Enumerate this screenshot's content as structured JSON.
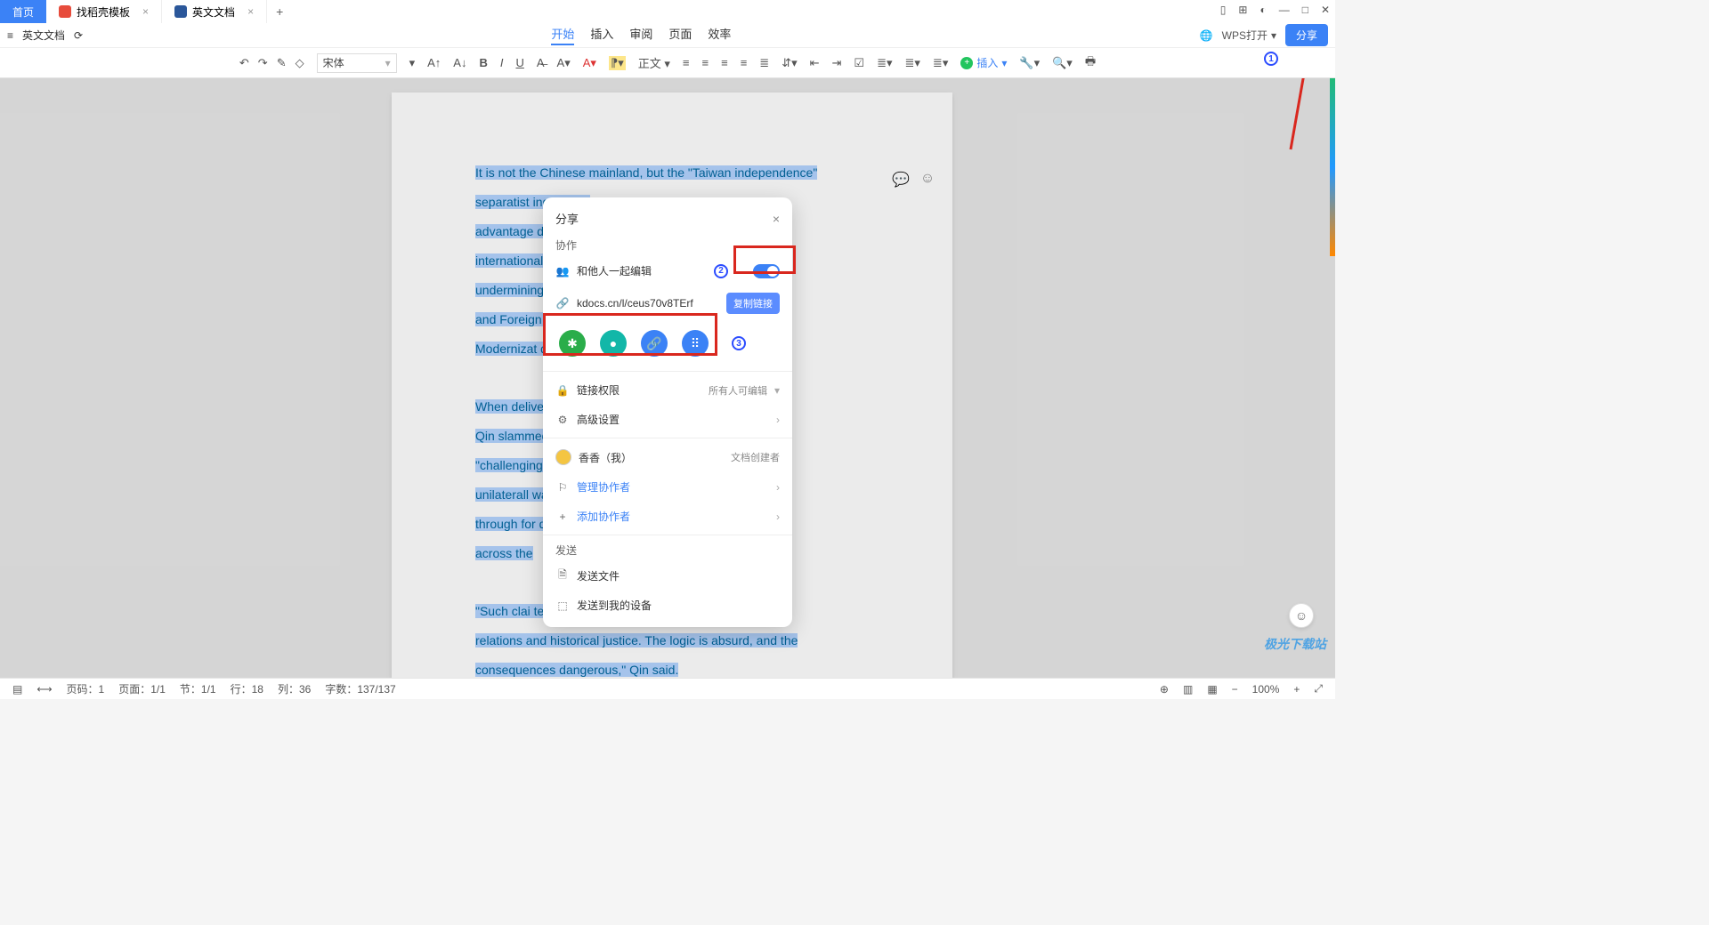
{
  "tabs": {
    "home": "首页",
    "t1": "找稻壳模板",
    "t2": "英文文档"
  },
  "subbar": {
    "docname": "英文文档"
  },
  "menu": {
    "start": "开始",
    "insert": "插入",
    "review": "审阅",
    "page": "页面",
    "eff": "效率",
    "wpsopen": "WPS打开",
    "share": "分享"
  },
  "toolbar": {
    "font": "宋体",
    "body": "正文",
    "insert": "插入"
  },
  "doc_text": {
    "p1a": "It is not the Chinese mainland, but the \"Taiwan independence\"",
    "p1b": "separatist                                        ing to take",
    "p1c": "advantage                                         disrupting",
    "p1d": "international                                     quo, and",
    "p1e": "undermining                                       e Councilor",
    "p1f": "and Foreign                                       on Chinese",
    "p1g": "Modernizat                                        day.",
    "p2a": "When deliver                                      the forum,",
    "p2b": "Qin slammed                                       ed China of",
    "p2c": "\"challenging                                      order,\" of",
    "p2d": "unilaterall                                       wan Straits",
    "p2e": "through for                                       d stability",
    "p2f": "across the",
    "p3a": "\"Such clai                                        ternational",
    "p3b": "relations and historical justice. The logic is absurd, and the",
    "p3c": "consequences dangerous,\" Qin said."
  },
  "dialog": {
    "title": "分享",
    "collab": "协作",
    "edit_together": "和他人一起编辑",
    "link": "kdocs.cn/l/ceus70v8TErf",
    "copy": "复制链接",
    "perm_label": "链接权限",
    "perm_val": "所有人可编辑",
    "adv": "高级设置",
    "owner": "香香（我）",
    "owner_role": "文档创建者",
    "manage": "管理协作者",
    "add": "添加协作者",
    "send": "发送",
    "sendfile": "发送文件",
    "senddev": "发送到我的设备"
  },
  "status": {
    "page": "页码：1",
    "pages": "页面：1/1",
    "sec": "节：1/1",
    "line": "行：18",
    "col": "列：36",
    "words": "字数：137/137",
    "zoom": "100%"
  },
  "badges": {
    "b1": "1",
    "b2": "2",
    "b3": "3"
  },
  "logo": "极光下载站"
}
